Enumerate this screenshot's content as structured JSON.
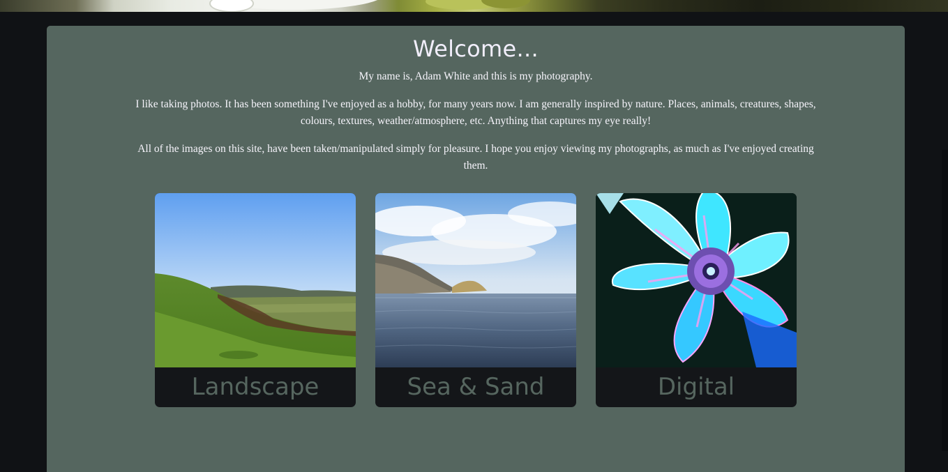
{
  "header": {
    "hero_icon": "flower-photo-banner"
  },
  "welcome": {
    "title": "Welcome...",
    "intro": "My name is, Adam White and this is my photography.",
    "paragraph_1": "I like taking photos. It has been something I've enjoyed as a hobby, for many years now. I am generally inspired by nature. Places, animals, creatures, shapes, colours, textures, weather/atmosphere, etc. Anything that captures my eye really!",
    "paragraph_2": "All of the images on this site, have been taken/manipulated simply for pleasure. I hope you enjoy viewing my photographs, as much as I've enjoyed creating them."
  },
  "galleries": [
    {
      "label": "Landscape"
    },
    {
      "label": "Sea & Sand"
    },
    {
      "label": "Digital"
    }
  ],
  "colors": {
    "page_background": "#101215",
    "panel_background": "#55665f",
    "tile_background": "#141619",
    "caption_text": "#56665f",
    "body_text": "#f6f4fb"
  }
}
